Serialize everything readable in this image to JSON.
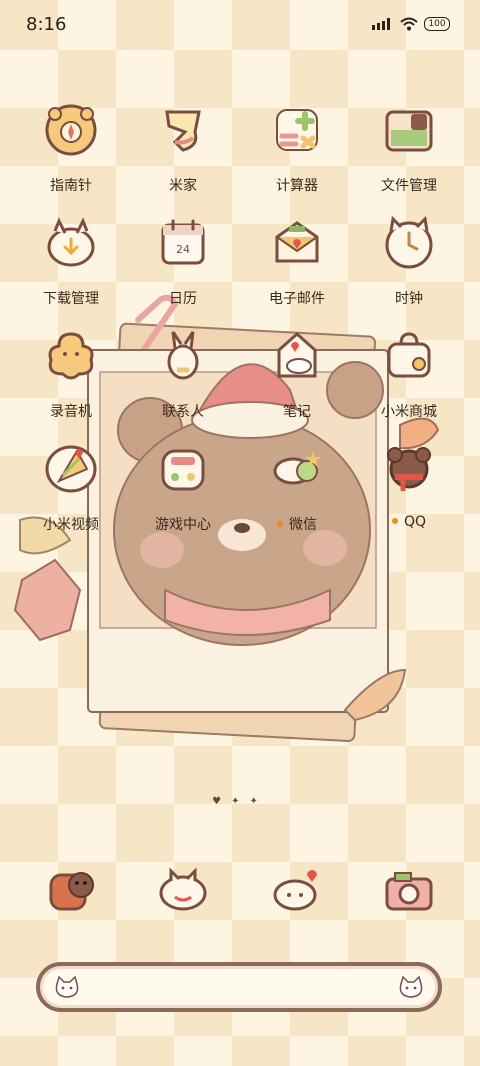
{
  "status_bar": {
    "time": "8:16",
    "battery": "100",
    "icons": [
      "signal-icon",
      "wifi-icon",
      "battery-icon"
    ]
  },
  "apps": [
    {
      "label": "指南针",
      "icon": "compass-icon",
      "badge": false
    },
    {
      "label": "米家",
      "icon": "mijia-icon",
      "badge": false
    },
    {
      "label": "计算器",
      "icon": "calculator-icon",
      "badge": false
    },
    {
      "label": "文件管理",
      "icon": "file-manager-icon",
      "badge": false
    },
    {
      "label": "下载管理",
      "icon": "download-manager-icon",
      "badge": false
    },
    {
      "label": "日历",
      "icon": "calendar-icon",
      "badge": false,
      "icon_text": "24"
    },
    {
      "label": "电子邮件",
      "icon": "email-icon",
      "badge": false
    },
    {
      "label": "时钟",
      "icon": "clock-icon",
      "badge": false
    },
    {
      "label": "录音机",
      "icon": "recorder-icon",
      "badge": false
    },
    {
      "label": "联系人",
      "icon": "contacts-icon",
      "badge": false
    },
    {
      "label": "笔记",
      "icon": "notes-icon",
      "badge": false
    },
    {
      "label": "小米商城",
      "icon": "mi-store-icon",
      "badge": false
    },
    {
      "label": "小米视频",
      "icon": "mi-video-icon",
      "badge": false
    },
    {
      "label": "游戏中心",
      "icon": "game-center-icon",
      "badge": false
    },
    {
      "label": "微信",
      "icon": "wechat-icon",
      "badge": true
    },
    {
      "label": "QQ",
      "icon": "qq-icon",
      "badge": true
    }
  ],
  "page_indicator": [
    "heart",
    "diamond",
    "diamond"
  ],
  "dock": [
    {
      "icon": "phone-icon"
    },
    {
      "icon": "messages-icon"
    },
    {
      "icon": "browser-icon"
    },
    {
      "icon": "camera-icon"
    }
  ],
  "search_bar": {
    "left_icon": "cat-face-icon",
    "right_icon": "cat-face-icon"
  },
  "colors": {
    "checker_light": "#fdf5e2",
    "checker_dark": "#f6e6c6",
    "badge_dot": "#f08a22",
    "icon_outline": "#7a4d3f"
  }
}
